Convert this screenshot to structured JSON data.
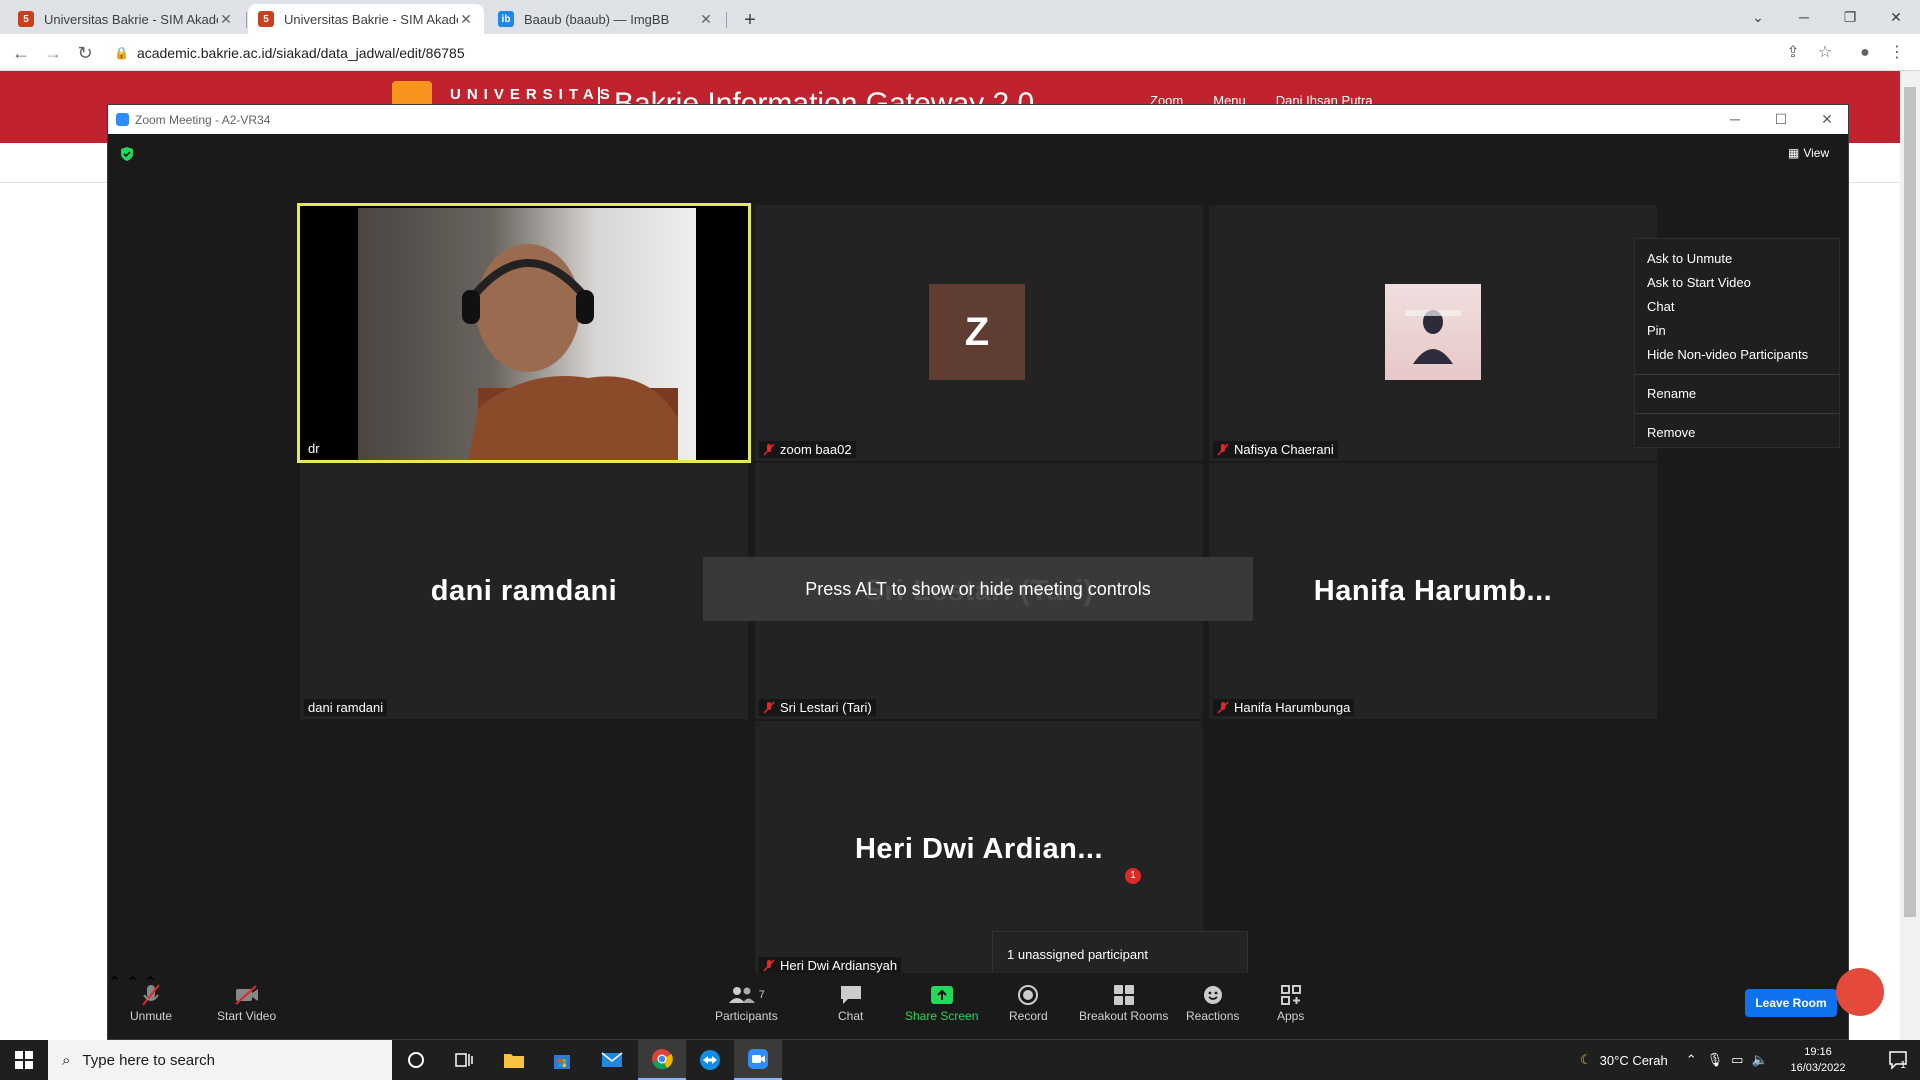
{
  "browser": {
    "tabs": [
      {
        "title": "Universitas Bakrie - SIM Akadem",
        "active": false
      },
      {
        "title": "Universitas Bakrie - SIM Akadem",
        "active": true
      },
      {
        "title": "Baaub (baaub) — ImgBB",
        "active": false
      }
    ],
    "url": "academic.bakrie.ac.id/siakad/data_jadwal/edit/86785"
  },
  "site": {
    "university": "UNIVERSITAS",
    "gateway_title": "Bakrie Information Gateway 2.0",
    "menu": [
      "Zoom",
      "Menu",
      "Dani Ihsan Putra"
    ]
  },
  "zoom": {
    "window_title": "Zoom Meeting - A2-VR34",
    "view_label": "View",
    "tiles": [
      {
        "name": "dr",
        "big_name": "",
        "muted": false
      },
      {
        "name": "zoom baa02",
        "big_name": "Z",
        "muted": true
      },
      {
        "name": "Nafisya Chaerani",
        "big_name": "",
        "muted": true
      },
      {
        "name": "dani ramdani",
        "big_name": "dani ramdani",
        "muted": false
      },
      {
        "name": "Sri Lestari (Tari)",
        "big_name": "Sri Lestari (Tari)",
        "muted": true
      },
      {
        "name": "Hanifa Harumbunga",
        "big_name": "Hanifa  Harumb...",
        "muted": true
      },
      {
        "name": "Heri Dwi Ardiansyah",
        "big_name": "Heri  Dwi  Ardian...",
        "muted": true
      }
    ],
    "context_menu": [
      "Ask to Unmute",
      "Ask to Start Video",
      "Chat",
      "Pin",
      "Hide Non-video Participants",
      "Rename",
      "Remove"
    ],
    "toast": "Press ALT to show or hide meeting controls",
    "unassigned": "1 unassigned participant",
    "controls": {
      "unmute": "Unmute",
      "start_video": "Start Video",
      "participants": "Participants",
      "participants_count": "7",
      "chat": "Chat",
      "share_screen": "Share Screen",
      "record": "Record",
      "breakout_rooms": "Breakout Rooms",
      "breakout_badge": "1",
      "reactions": "Reactions",
      "apps": "Apps",
      "leave": "Leave Room"
    },
    "colors": {
      "accent": "#0e72ed",
      "share_green": "#23d959",
      "active_border": "#e6e855"
    }
  },
  "taskbar": {
    "search_placeholder": "Type here to search",
    "weather": "30°C  Cerah",
    "time": "19:16",
    "date": "16/03/2022",
    "notification_count": "1"
  }
}
